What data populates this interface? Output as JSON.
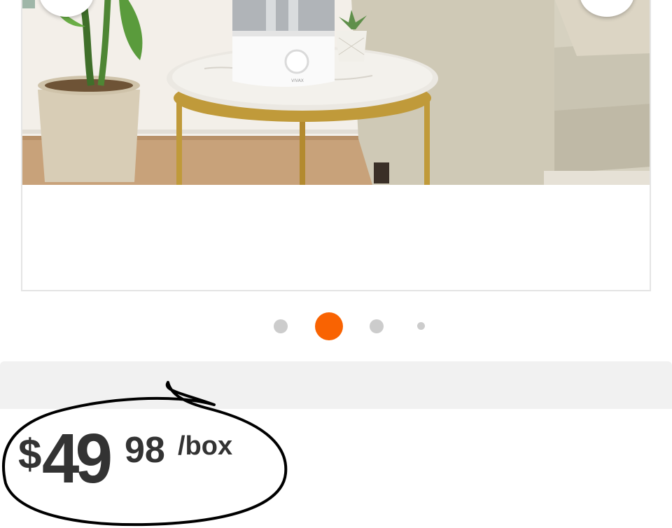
{
  "carousel": {
    "prev_icon": "‹",
    "next_icon": "›",
    "dots": 4,
    "active_index": 1,
    "accent_color": "#f96302"
  },
  "product_image": {
    "brand_text": "VIVAX"
  },
  "price": {
    "currency": "$",
    "dollars": "49",
    "cents": "98",
    "unit": "/box",
    "text_color": "#333333"
  },
  "annotation": {
    "type": "hand-drawn circle",
    "color": "#000000"
  }
}
